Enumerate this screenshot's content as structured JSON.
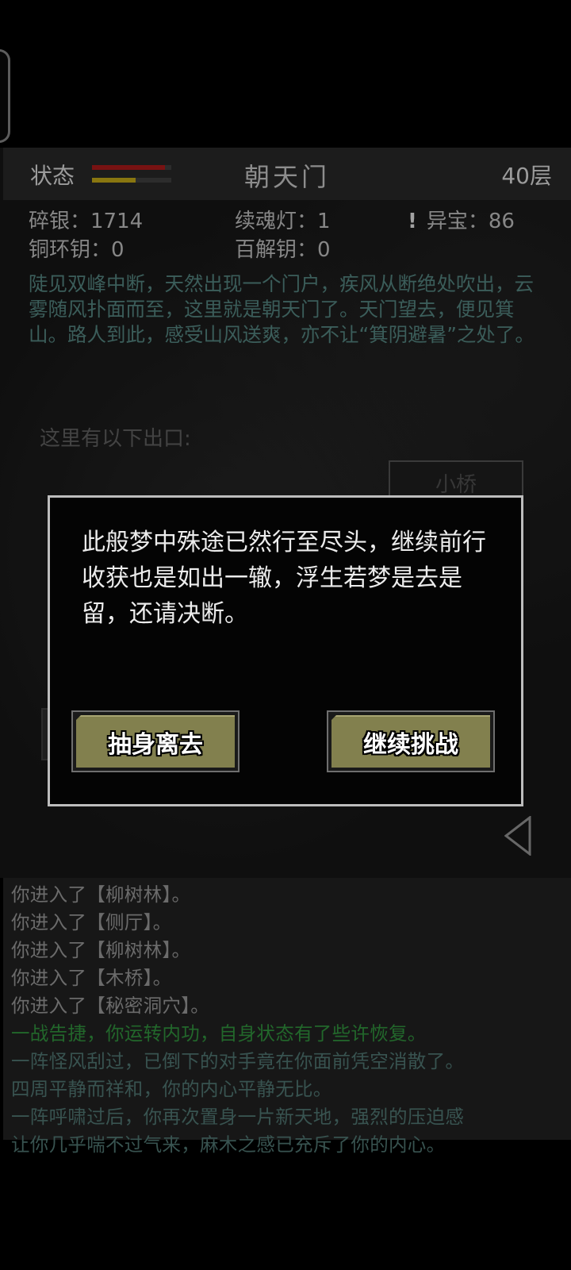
{
  "header": {
    "status_label": "状态",
    "hp_fraction": 0.92,
    "mp_fraction": 0.55,
    "location": "朝天门",
    "floor": "40层"
  },
  "stats": {
    "silver": "碎银：1714",
    "soul_lamp": "续魂灯：1",
    "treasure_mark": "!",
    "treasure": "异宝：86",
    "bronze_key": "铜环钥：0",
    "master_key": "百解钥：0"
  },
  "description": "陡见双峰中断，天然出现一个门户，疾风从断绝处吹出，云雾随风扑面而至，这里就是朝天门了。天门望去，便见箕山。路人到此，感受山风送爽，亦不让“箕阴避暑”之处了。",
  "exits": {
    "label": "这里有以下出口:",
    "items": [
      "小桥"
    ]
  },
  "modal": {
    "message": "此般梦中殊途已然行至尽头，继续前行收获也是如出一辙，浮生若梦是去是留，还请决断。",
    "leave_label": "抽身离去",
    "continue_label": "继续挑战"
  },
  "log": [
    {
      "text": "你进入了【柳树林】。",
      "tone": "gray"
    },
    {
      "text": "你进入了【侧厅】。",
      "tone": "gray"
    },
    {
      "text": "你进入了【柳树林】。",
      "tone": "gray"
    },
    {
      "text": "你进入了【木桥】。",
      "tone": "gray"
    },
    {
      "text": "你进入了【秘密洞穴】。",
      "tone": "gray"
    },
    {
      "text": "一战告捷，你运转内功，自身状态有了些许恢复。",
      "tone": "green"
    },
    {
      "text": "一阵怪风刮过，已倒下的对手竟在你面前凭空消散了。",
      "tone": "teal"
    },
    {
      "text": "四周平静而祥和，你的内心平静无比。",
      "tone": "teal"
    },
    {
      "text": "一阵呼啸过后，你再次置身一片新天地，强烈的压迫感",
      "tone": "teal"
    },
    {
      "text": "让你几乎喘不过气来，麻木之感已充斥了你的内心。",
      "tone": "teal"
    }
  ],
  "colors": {
    "hp": "#a01818",
    "mp": "#b79e16",
    "description": "#4f7d78",
    "log_green": "#2e8a3a",
    "button_face": "#82804e"
  }
}
